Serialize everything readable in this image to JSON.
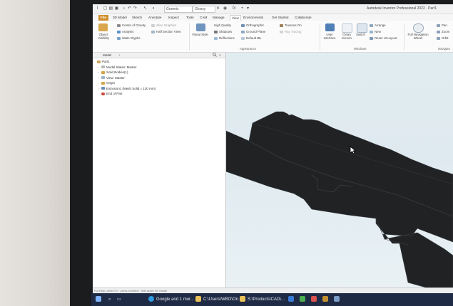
{
  "window": {
    "title": "Autodesk Inventor Professional 2022 · Part1",
    "appearance_combo": "Generic",
    "material_combo": "Glossy",
    "formula_glyph": "fx"
  },
  "ribbon_tabs": [
    "File",
    "3D Model",
    "Sketch",
    "Annotate",
    "Inspect",
    "Tools",
    "CAM",
    "Manage",
    "View",
    "Environments",
    "Get Started",
    "Collaborate"
  ],
  "active_tab": "View",
  "ribbon": {
    "visibility": [
      "Center of Gravity",
      "Analysis",
      "iMate Glyphs"
    ],
    "object_visibility": "Object Visibility",
    "sketch_slice": "Slice Graphics",
    "half_section": "Half Section View",
    "visual_style": "Visual Style",
    "quality": "High Quality",
    "shadows": "Shadows",
    "reflections": "Reflections",
    "ortho": "Orthographic",
    "ground_plane": "Ground Plane",
    "default_ibl": "Default IBL",
    "textures": "Textures On",
    "ray_trace": "Ray Tracing",
    "user_interface": "User Interface",
    "clean_screen": "Clean Screen",
    "switch": "Switch",
    "arrange": "Arrange",
    "new": "New",
    "reset_layout": "Reset UI Layout",
    "full_nav": "Full Navigation Wheel",
    "pan": "Pan",
    "zoom": "Zoom",
    "orbit": "Orbit",
    "appearance_group": "Appearance",
    "windows_group": "Windows",
    "navigate_group": "Navigate"
  },
  "browser": {
    "tab_label": "Model",
    "search_icon": "search-icon",
    "tree": [
      "Part1",
      "Model States: Master",
      "Solid Bodies(1)",
      "View: Master",
      "Origin",
      "Extrusion1 (Mesh Solid = 130 mm)",
      "End of Part"
    ]
  },
  "status_text": "For Help, press F1  ·  press of select  ·  edit active 3D Model",
  "taskbar": {
    "items": [
      "Google and 1 mor...",
      "C:\\Users\\WBO\\On...",
      "S:\\Products\\CAD\\..."
    ]
  },
  "colors": {
    "file_tab": "#d08f2e",
    "viewport_bg": "#e1ecf1",
    "part": "#202224",
    "taskbar": "#1f2a44"
  }
}
